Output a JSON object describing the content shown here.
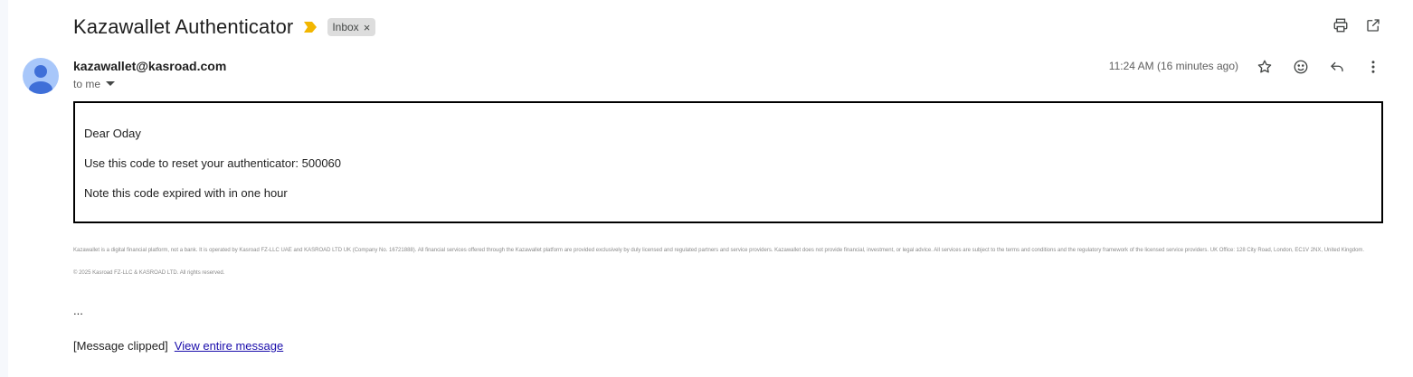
{
  "email": {
    "subject": "Kazawallet Authenticator",
    "label": "Inbox",
    "label_remove": "×",
    "sender_email": "kazawallet@kasroad.com",
    "recipient": "to me",
    "timestamp": "11:24 AM (16 minutes ago)",
    "body": {
      "greeting": "Dear Oday",
      "code_line": "Use this code to reset your authenticator: 500060",
      "note_line": "Note this code expired with in one hour"
    },
    "footer": {
      "disclaimer": "Kazawallet is a digital financial platform, not a bank. It is operated by Kasroad FZ-LLC UAE and KASROAD LTD UK (Company No. 16721888). All financial services offered through the Kazawallet platform are provided exclusively by duly licensed and regulated partners and service providers. Kazawallet does not provide financial, investment, or legal advice. All services are subject to the terms and conditions and the regulatory framework of the licensed service providers. UK Office: 128 City Road, London, EC1V 2NX, United Kingdom.",
      "copyright": "© 2025 Kasroad FZ-LLC & KASROAD LTD. All rights reserved."
    },
    "ellipsis": "...",
    "clipped_text": "[Message clipped]",
    "view_entire_link": "View entire message"
  },
  "icons": {
    "importance": "importance-marker-icon",
    "print": "print-icon",
    "open_new_window": "open-in-new-window-icon",
    "star": "star-icon",
    "emoji": "emoji-react-icon",
    "reply": "reply-icon",
    "more": "more-vert-icon",
    "dropdown": "chevron-down-icon",
    "avatar": "person-icon"
  },
  "colors": {
    "importance": "#f2b600",
    "chip_bg": "#dddddd",
    "link": "#1a0dab",
    "avatar_bg": "#a8c7fa",
    "avatar_fg": "#3f6fd8"
  }
}
